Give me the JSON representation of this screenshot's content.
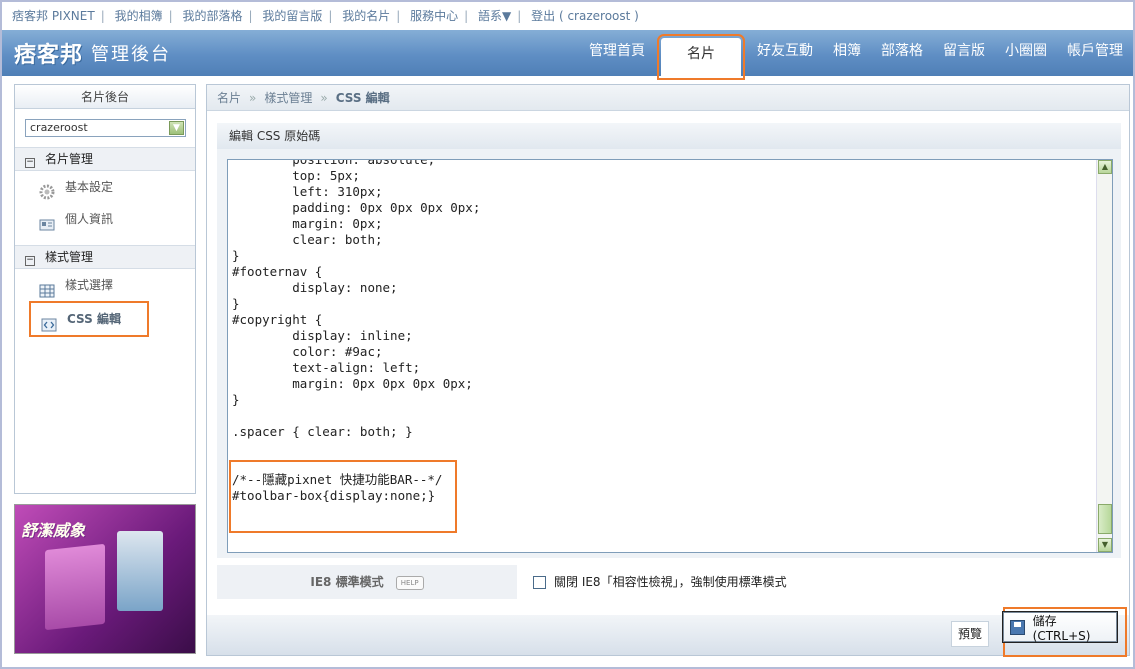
{
  "top_links": [
    "痞客邦 PIXNET",
    "我的相簿",
    "我的部落格",
    "我的留言版",
    "我的名片",
    "服務中心",
    "語系▼",
    "登出 ( crazeroost )"
  ],
  "header": {
    "logo": "痞客邦",
    "subtitle": "管理後台",
    "tabs": [
      "管理首頁",
      "名片",
      "好友互動",
      "相簿",
      "部落格",
      "留言版",
      "小圈圈",
      "帳戶管理"
    ],
    "active_tab": "名片"
  },
  "sidebar": {
    "title": "名片後台",
    "account_select": "crazeroost",
    "sections": [
      {
        "label": "名片管理",
        "items": [
          "基本設定",
          "個人資訊"
        ]
      },
      {
        "label": "樣式管理",
        "items": [
          "樣式選擇",
          "CSS 編輯"
        ]
      }
    ],
    "ad_text": "舒潔威象"
  },
  "breadcrumb": [
    "名片",
    "樣式管理",
    "CSS 編輯"
  ],
  "editor": {
    "title": "編輯 CSS 原始碼",
    "code": "        position: absolute;\n        top: 5px;\n        left: 310px;\n        padding: 0px 0px 0px 0px;\n        margin: 0px;\n        clear: both;\n}\n#footernav {\n        display: none;\n}\n#copyright {\n        display: inline;\n        color: #9ac;\n        text-align: left;\n        margin: 0px 0px 0px 0px;\n}\n\n.spacer { clear: both; }\n\n\n/*--隱藏pixnet 快捷功能BAR--*/\n#toolbar-box{display:none;}"
  },
  "ie8": {
    "label": "IE8 標準模式",
    "help": "HELP",
    "checkbox_label": "關閉 IE8「相容性檢視」，強制使用標準模式"
  },
  "buttons": {
    "preview": "預覽",
    "save": "儲存 (CTRL+S)"
  },
  "colors": {
    "header": "#5f8ec4",
    "highlight": "#ef7a2a"
  }
}
